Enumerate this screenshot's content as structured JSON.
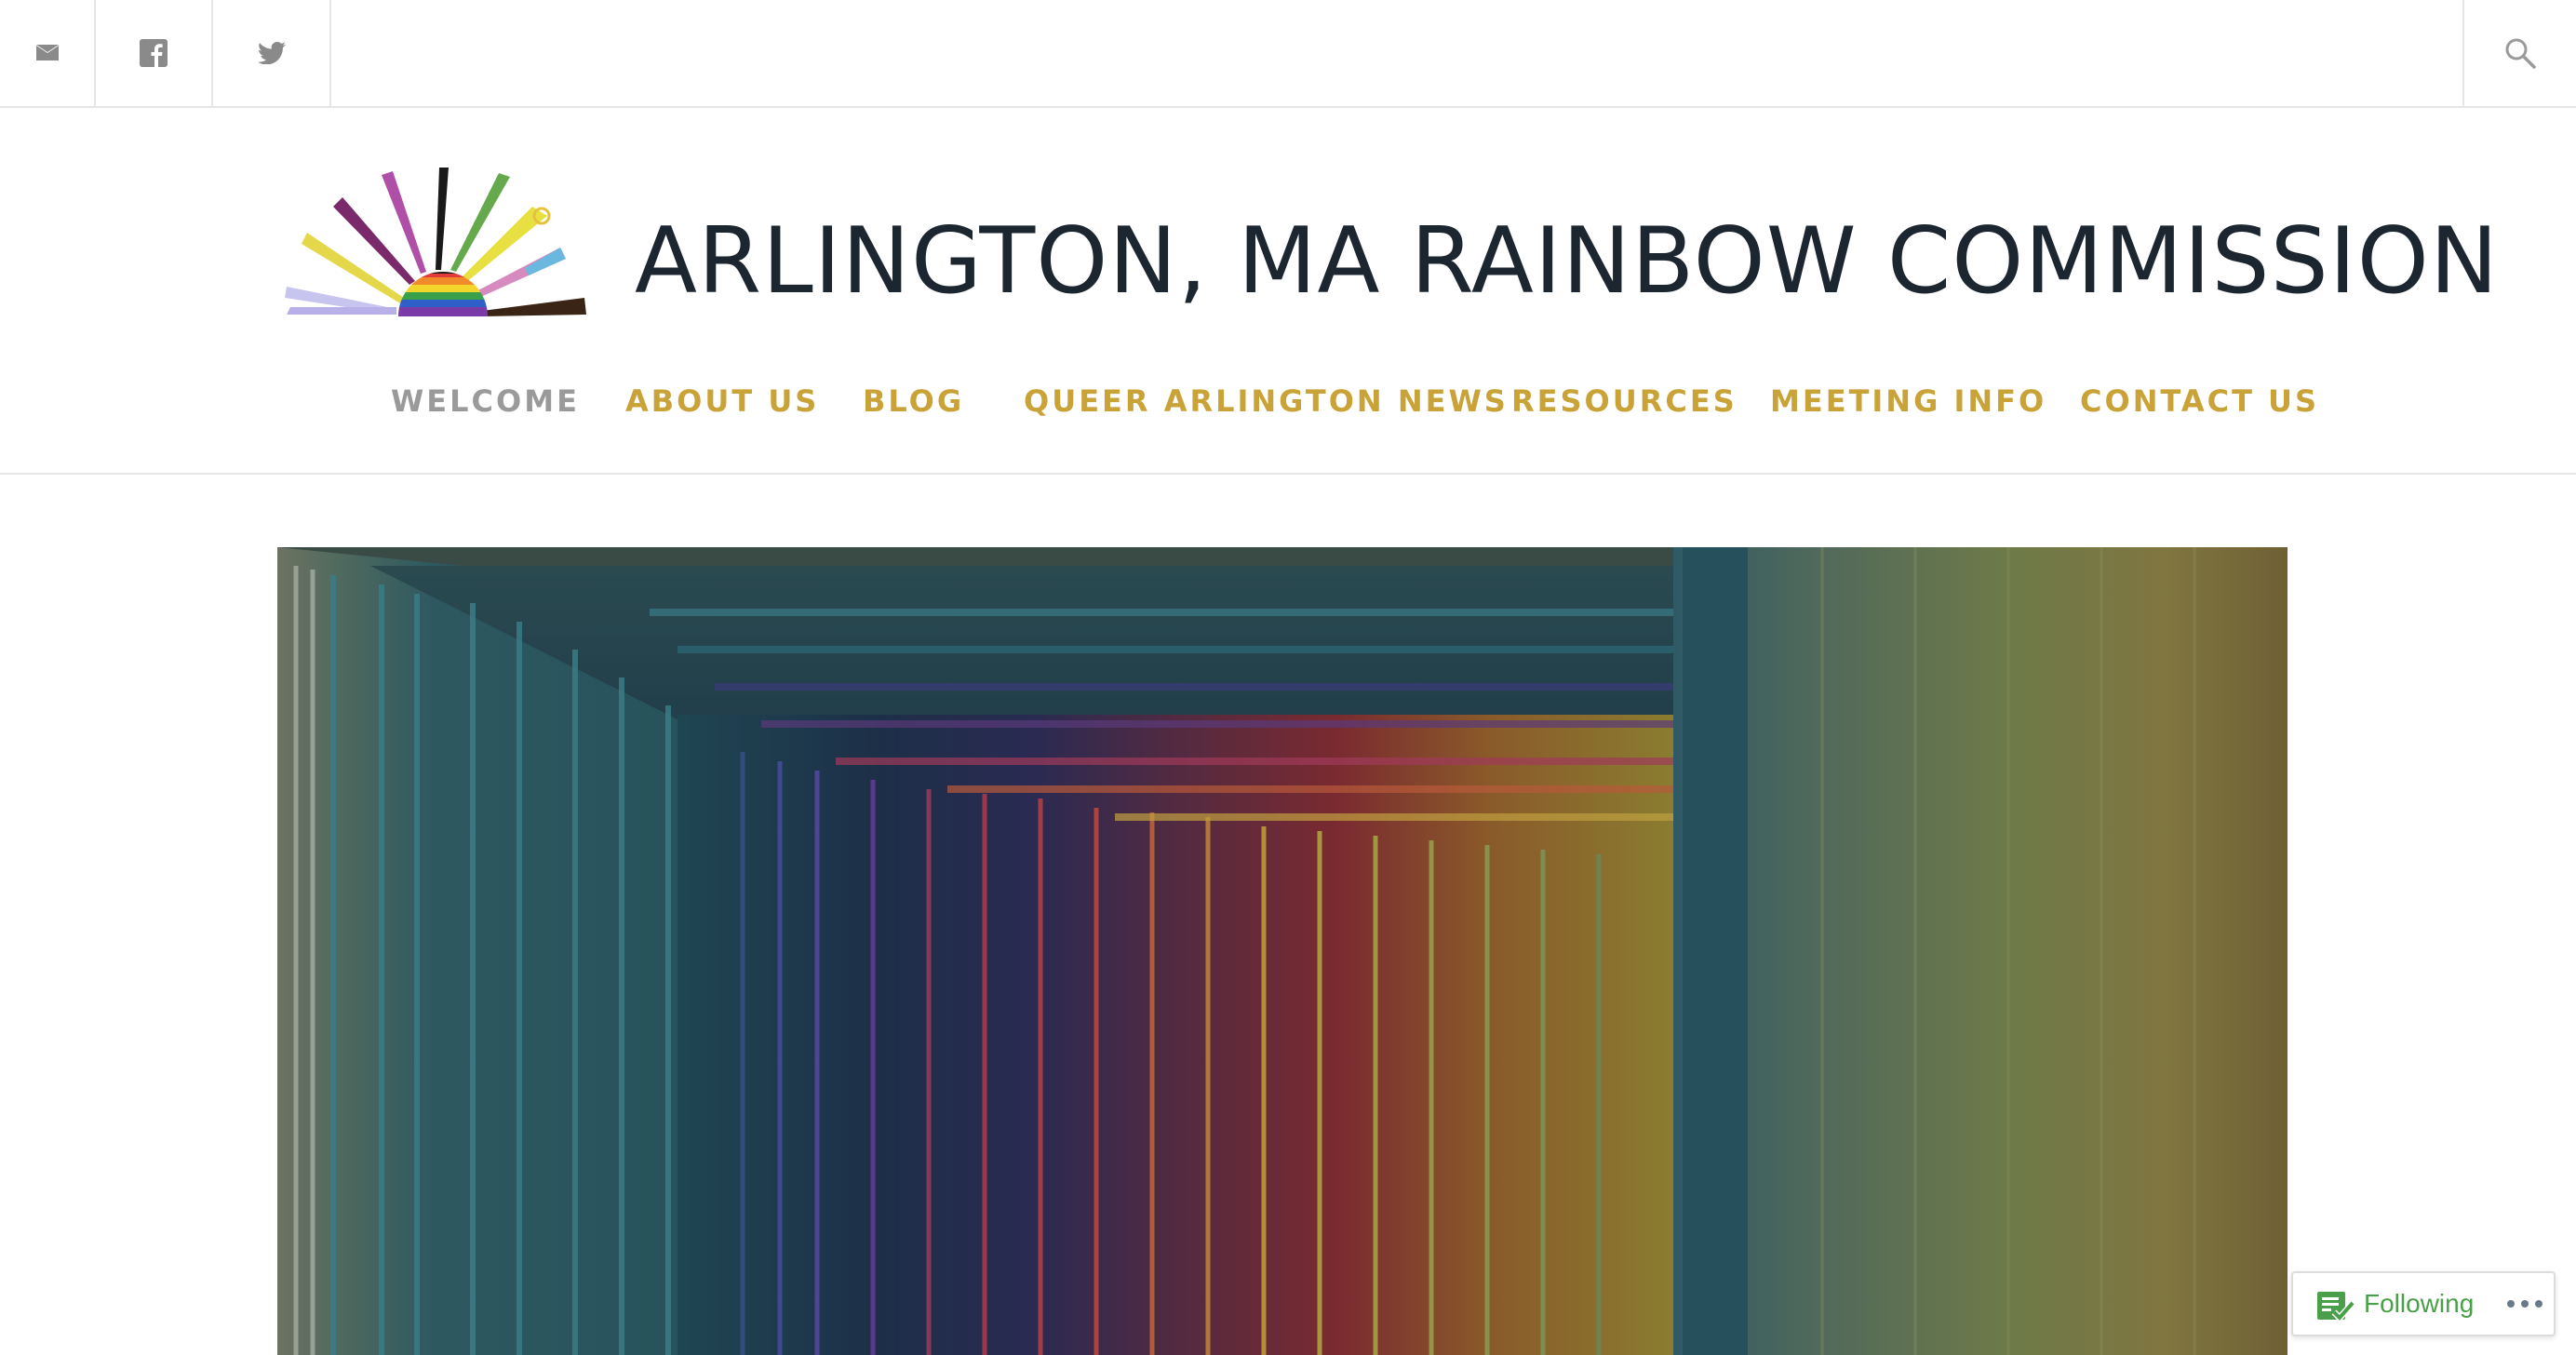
{
  "social": {
    "mail_icon": "envelope-icon",
    "facebook_icon": "facebook-icon",
    "twitter_icon": "twitter-icon",
    "search_icon": "search-icon"
  },
  "site": {
    "title": "ARLINGTON, MA RAINBOW COMMISSION"
  },
  "nav": {
    "items": [
      {
        "label": "WELCOME",
        "active": true
      },
      {
        "label": "ABOUT US"
      },
      {
        "label": "BLOG"
      },
      {
        "label": "QUEER ARLINGTON NEWS"
      },
      {
        "label": "RESOURCES"
      },
      {
        "label": "MEETING INFO"
      },
      {
        "label": "CONTACT US"
      }
    ]
  },
  "follow": {
    "label": "Following"
  },
  "colors": {
    "nav_link": "#c9a338",
    "nav_active": "#9a9a9a",
    "title": "#1c2630",
    "follow_green": "#4aa04a"
  }
}
